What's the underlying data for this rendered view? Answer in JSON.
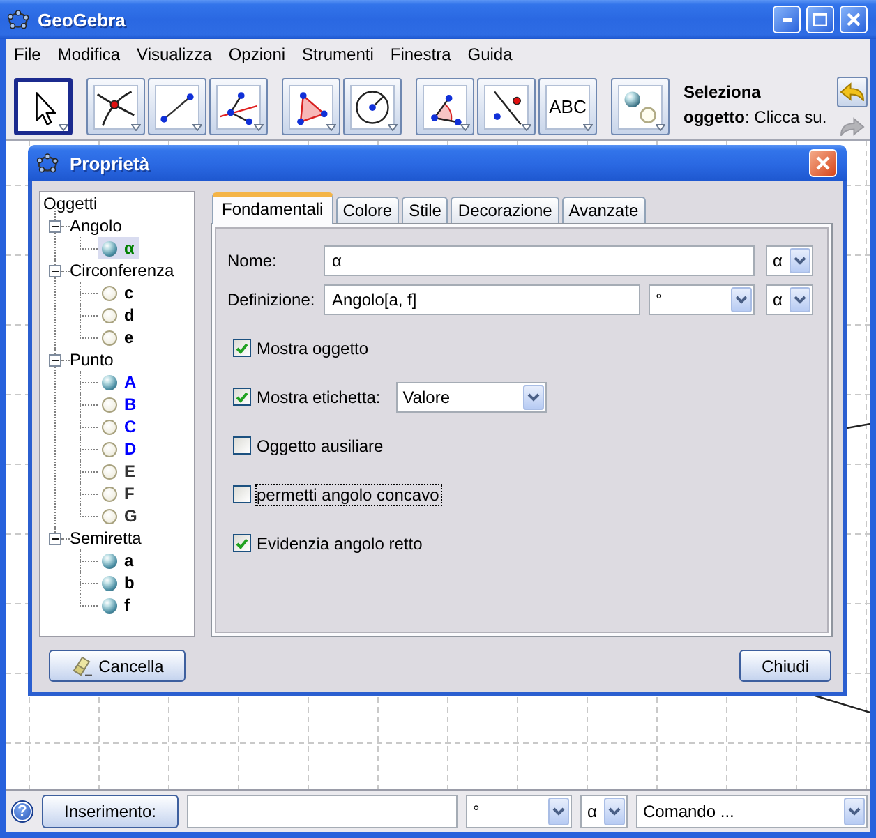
{
  "window": {
    "title": "GeoGebra"
  },
  "menu": [
    "File",
    "Modifica",
    "Visualizza",
    "Opzioni",
    "Strumenti",
    "Finestra",
    "Guida"
  ],
  "toolbar": {
    "groups": [
      {
        "tools": [
          {
            "kind": "move",
            "selected": true
          }
        ]
      },
      {
        "tools": [
          {
            "kind": "intersect",
            "selected": false
          },
          {
            "kind": "segment",
            "selected": false
          },
          {
            "kind": "perpendicular",
            "selected": false
          }
        ]
      },
      {
        "tools": [
          {
            "kind": "polygon",
            "selected": false
          },
          {
            "kind": "circle",
            "selected": false
          }
        ]
      },
      {
        "tools": [
          {
            "kind": "angle",
            "selected": false
          },
          {
            "kind": "reflect",
            "selected": false
          },
          {
            "kind": "text",
            "label": "ABC",
            "selected": false
          }
        ]
      },
      {
        "tools": [
          {
            "kind": "toggle",
            "selected": false
          }
        ]
      }
    ],
    "hint": "**Seleziona**\n**oggetto**: Clicca su.",
    "history": [
      {
        "kind": "undo",
        "disabled": false
      },
      {
        "kind": "redo",
        "disabled": true
      }
    ]
  },
  "dialog": {
    "title": "Proprietà",
    "tree": {
      "label": "Oggetti",
      "children": [
        {
          "label": "Angolo",
          "expanded": true,
          "children": [
            {
              "label": "α",
              "shown": true,
              "selected": true,
              "color": "#008000"
            }
          ]
        },
        {
          "label": "Circonferenza",
          "expanded": true,
          "children": [
            {
              "label": "c",
              "shown": false,
              "selected": false,
              "color": "#000000"
            },
            {
              "label": "d",
              "shown": false,
              "selected": false,
              "color": "#000000"
            },
            {
              "label": "e",
              "shown": false,
              "selected": false,
              "color": "#000000"
            }
          ]
        },
        {
          "label": "Punto",
          "expanded": true,
          "children": [
            {
              "label": "A",
              "shown": true,
              "selected": false,
              "color": "#0000ff"
            },
            {
              "label": "B",
              "shown": false,
              "selected": false,
              "color": "#0000ff"
            },
            {
              "label": "C",
              "shown": false,
              "selected": false,
              "color": "#0000ff"
            },
            {
              "label": "D",
              "shown": false,
              "selected": false,
              "color": "#0000ff"
            },
            {
              "label": "E",
              "shown": false,
              "selected": false,
              "color": "#333333"
            },
            {
              "label": "F",
              "shown": false,
              "selected": false,
              "color": "#333333"
            },
            {
              "label": "G",
              "shown": false,
              "selected": false,
              "color": "#333333"
            }
          ]
        },
        {
          "label": "Semiretta",
          "expanded": true,
          "children": [
            {
              "label": "a",
              "shown": true,
              "selected": false,
              "color": "#000000"
            },
            {
              "label": "b",
              "shown": true,
              "selected": false,
              "color": "#000000"
            },
            {
              "label": "f",
              "shown": true,
              "selected": false,
              "color": "#000000"
            }
          ]
        }
      ]
    },
    "tabs": [
      {
        "label": "Fondamentali",
        "selected": true
      },
      {
        "label": "Colore",
        "selected": false
      },
      {
        "label": "Stile",
        "selected": false
      },
      {
        "label": "Decorazione",
        "selected": false
      },
      {
        "label": "Avanzate",
        "selected": false
      }
    ],
    "fields": [
      {
        "label": "Nome:",
        "value": "α",
        "combos": [
          {
            "kind": "symbol",
            "value": "α"
          }
        ]
      },
      {
        "label": "Definizione:",
        "value": "Angolo[a, f]",
        "combos": [
          {
            "kind": "unit",
            "value": "°"
          },
          {
            "kind": "symbol",
            "value": "α"
          }
        ]
      }
    ],
    "options": [
      {
        "label": "Mostra oggetto",
        "checked": true,
        "focused": false
      },
      {
        "label": "Mostra etichetta:",
        "checked": true,
        "focused": false,
        "combo": {
          "kind": "choice",
          "value": "Valore"
        }
      },
      {
        "label": "Oggetto ausiliare",
        "checked": false,
        "focused": false
      },
      {
        "label": "permetti angolo concavo",
        "checked": false,
        "focused": true
      },
      {
        "label": "Evidenzia angolo retto",
        "checked": true,
        "focused": false
      }
    ],
    "buttons": [
      {
        "kind": "delete",
        "label": "Cancella"
      },
      {
        "kind": "close",
        "label": "Chiudi"
      }
    ]
  },
  "input_bar": {
    "help": "?",
    "button": "Inserimento:",
    "combos": [
      {
        "kind": "unit",
        "value": "°"
      },
      {
        "kind": "symbol",
        "value": "α"
      },
      {
        "kind": "command",
        "value": "Comando ..."
      }
    ]
  }
}
